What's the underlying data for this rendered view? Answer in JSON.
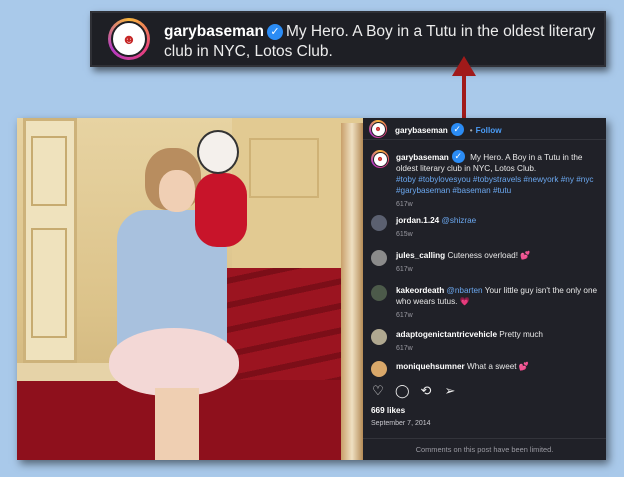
{
  "callout": {
    "username": "garybaseman",
    "caption": "My Hero. A Boy in a Tutu in the oldest literary club in NYC, Lotos Club."
  },
  "post": {
    "header_username": "garybaseman",
    "follow_label": "Follow",
    "caption_username": "garybaseman",
    "caption_text": "My Hero. A Boy in a Tutu in the oldest literary club in NYC, Lotos Club.",
    "hashtags": "#toby #tobylovesyou #tobystravels #newyork #ny #nyc #garybaseman #baseman #tutu",
    "caption_time": "617w",
    "likes": "669 likes",
    "date": "September 7, 2014",
    "limited_notice": "Comments on this post have been limited."
  },
  "comments": [
    {
      "username": "jordan.1.24",
      "mention": "@shizrae",
      "text": "",
      "emoji": "",
      "time": "615w",
      "avatar_color": "#5b6070"
    },
    {
      "username": "jules_calling",
      "mention": "",
      "text": "Cuteness overload!",
      "emoji": "💕",
      "time": "617w",
      "avatar_color": "#8b8b8b"
    },
    {
      "username": "kakeordeath",
      "mention": "@nbarten",
      "text": "Your little guy isn't the only one who wears tutus.",
      "emoji": "💗",
      "time": "617w",
      "avatar_color": "#4c5a4a"
    },
    {
      "username": "adaptogenictantricvehicle",
      "mention": "",
      "text": "Pretty much",
      "emoji": "",
      "time": "617w",
      "avatar_color": "#b0a890"
    },
    {
      "username": "moniquehsumner",
      "mention": "",
      "text": "What a sweet",
      "emoji": "💕",
      "time": "",
      "avatar_color": "#d9a86a"
    }
  ],
  "icons": {
    "like": "heart-icon",
    "comment": "comment-icon",
    "share": "share-icon",
    "verified": "verified-badge-icon"
  },
  "colors": {
    "follow": "#4a9bf5",
    "hashtag": "#6ba8f0",
    "arrow": "#a11a1a",
    "panel_bg": "#202128",
    "page_bg": "#a9c9ea"
  }
}
